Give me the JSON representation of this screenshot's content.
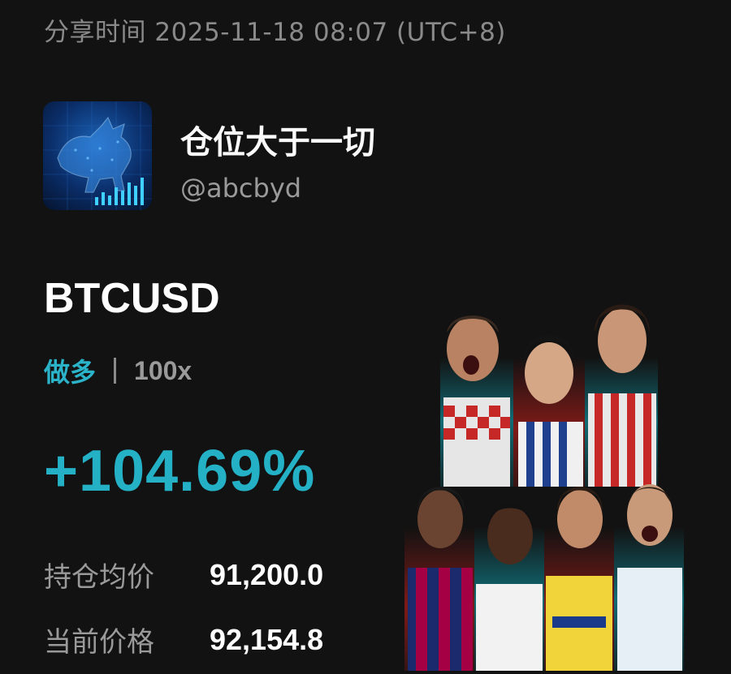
{
  "share": {
    "label": "分享时间",
    "datetime": "2025-11-18 08:07 (UTC+8)"
  },
  "profile": {
    "name": "仓位大于一切",
    "handle": "@abcbyd",
    "avatar_icon": "bull-chart-icon"
  },
  "position": {
    "symbol": "BTCUSD",
    "direction": "做多",
    "leverage": "100x",
    "roi": "+104.69%"
  },
  "stats": [
    {
      "label": "持仓均价",
      "value": "91,200.0"
    },
    {
      "label": "当前价格",
      "value": "92,154.8"
    }
  ],
  "colors": {
    "background": "#121212",
    "accent": "#24b1c6",
    "muted": "#9a9a9a"
  },
  "promo_image": {
    "icon": "football-players-collage-image"
  }
}
